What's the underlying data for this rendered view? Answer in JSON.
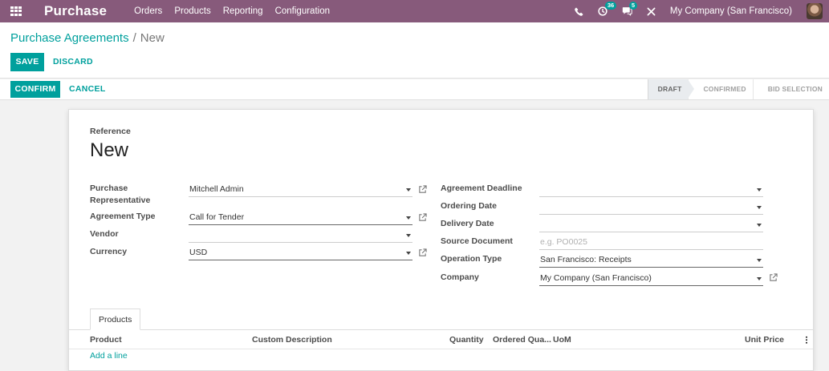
{
  "navbar": {
    "app_title": "Purchase",
    "menu": [
      "Orders",
      "Products",
      "Reporting",
      "Configuration"
    ],
    "activity_count": "36",
    "message_count": "5",
    "company": "My Company (San Francisco)"
  },
  "breadcrumb": {
    "parent": "Purchase Agreements",
    "separator": "/",
    "current": "New"
  },
  "buttons": {
    "save": "SAVE",
    "discard": "DISCARD",
    "confirm": "CONFIRM",
    "cancel": "CANCEL"
  },
  "stages": [
    "DRAFT",
    "CONFIRMED",
    "BID SELECTION"
  ],
  "form": {
    "reference_label": "Reference",
    "reference_value": "New",
    "left": {
      "purchase_rep_label": "Purchase Representative",
      "purchase_rep_value": "Mitchell Admin",
      "agreement_type_label": "Agreement Type",
      "agreement_type_value": "Call for Tender",
      "vendor_label": "Vendor",
      "vendor_value": "",
      "currency_label": "Currency",
      "currency_value": "USD"
    },
    "right": {
      "deadline_label": "Agreement Deadline",
      "deadline_value": "",
      "ordering_date_label": "Ordering Date",
      "ordering_date_value": "",
      "delivery_date_label": "Delivery Date",
      "delivery_date_value": "",
      "source_doc_label": "Source Document",
      "source_doc_placeholder": "e.g. PO0025",
      "operation_type_label": "Operation Type",
      "operation_type_value": "San Francisco: Receipts",
      "company_label": "Company",
      "company_value": "My Company (San Francisco)"
    }
  },
  "notebook": {
    "tab": "Products",
    "columns": {
      "product": "Product",
      "description": "Custom Description",
      "quantity": "Quantity",
      "ordered_qty": "Ordered Qua...",
      "uom": "UoM",
      "unit_price": "Unit Price"
    },
    "add_line": "Add a line"
  },
  "colors": {
    "navbar": "#875a7b",
    "primary": "#00a09d"
  }
}
